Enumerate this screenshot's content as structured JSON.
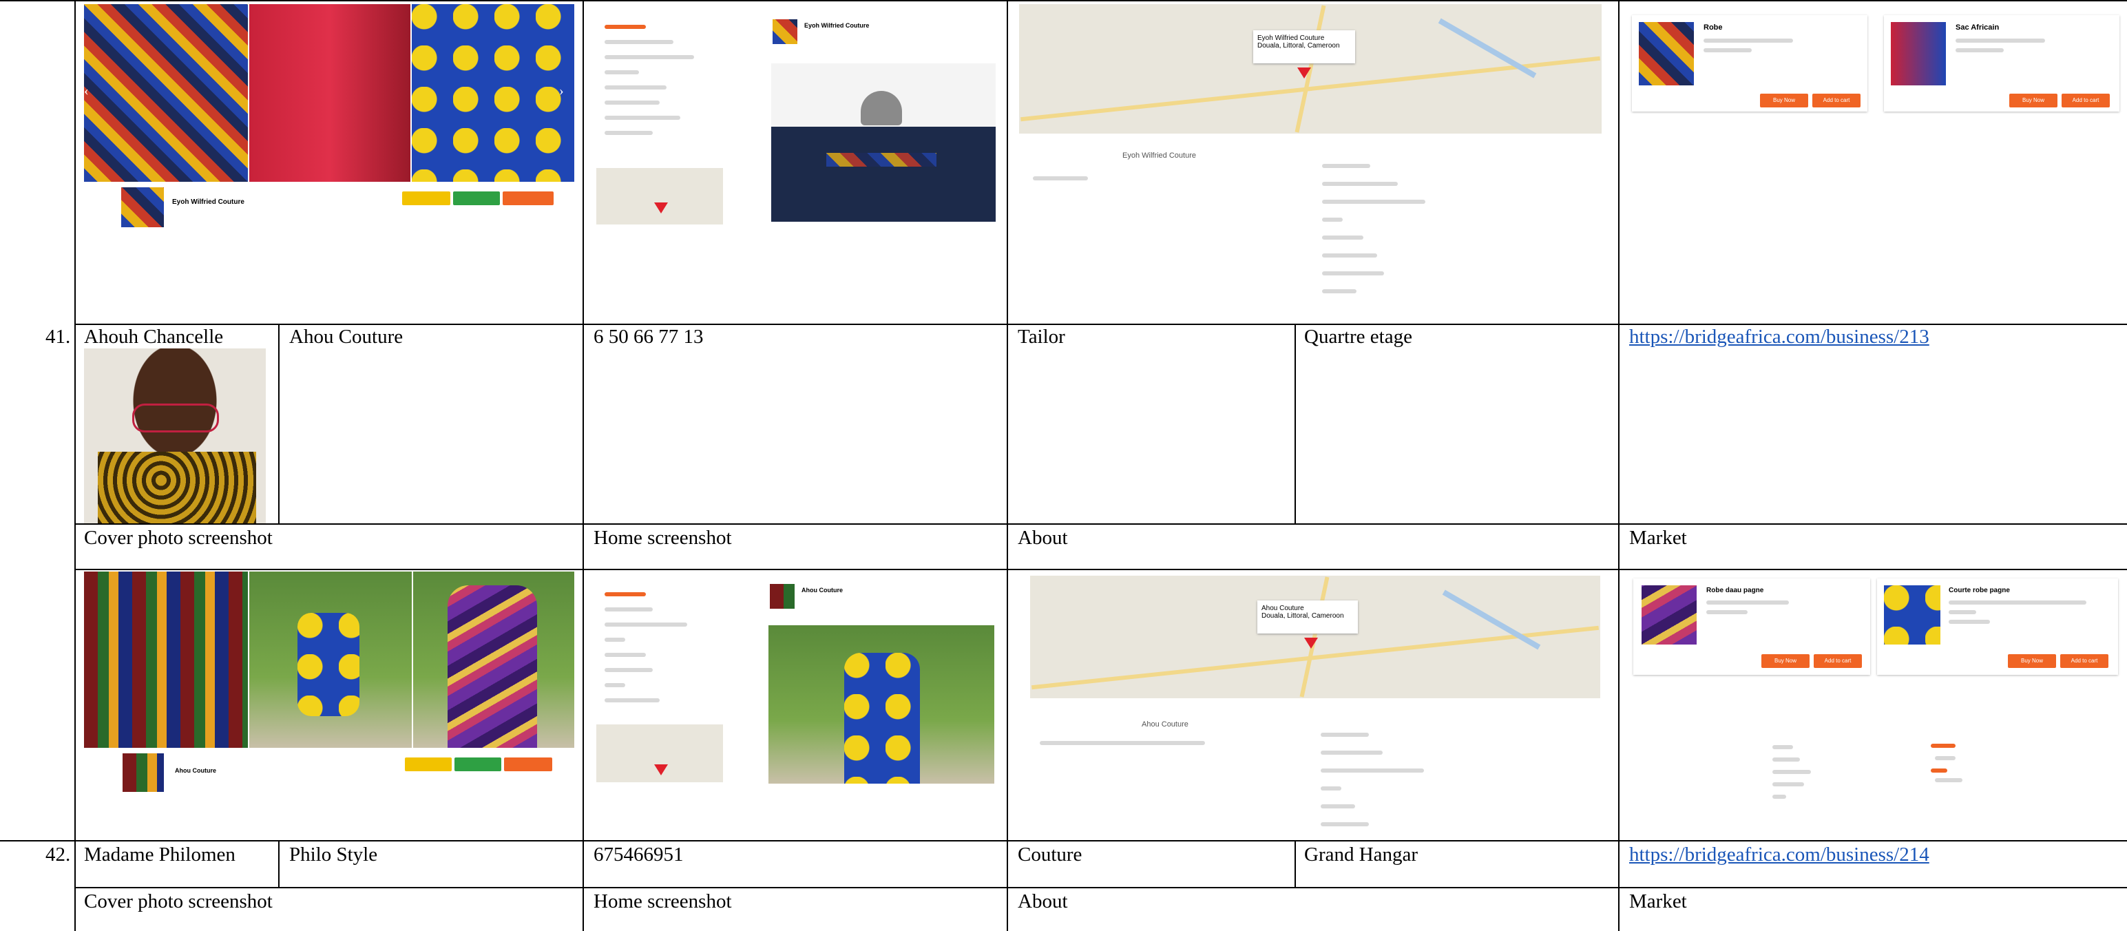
{
  "rows": {
    "r41": {
      "num": "41.",
      "owner": "Ahouh Chancelle",
      "business": "Ahou Couture",
      "phone": "6 50 66 77 13",
      "category": "Tailor",
      "location": "Quartre etage",
      "link": "https://bridgeafrica.com/business/213"
    },
    "r42": {
      "num": "42.",
      "owner": "Madame Philomen",
      "business": "Philo Style",
      "phone": "675466951",
      "category": "Couture",
      "location": "Grand Hangar",
      "link": "https://bridgeafrica.com/business/214"
    }
  },
  "sections": {
    "cover": "Cover photo screenshot",
    "home": "Home screenshot",
    "about": "About",
    "market": "Market"
  },
  "screenshots": {
    "top": {
      "cover_name": "Eyoh Wilfried Couture",
      "home_name": "Eyoh Wilfried Couture",
      "about_pin_label": "Eyoh Wilfried Couture",
      "about_map_popup": "Eyoh Wilfried Couture\nDouala, Littoral, Cameroon",
      "market_item1": "Robe",
      "market_item2": "Sac Africain",
      "buy_label": "Buy Now",
      "cart_label": "Add to cart"
    },
    "r41": {
      "cover_name": "Ahou Couture",
      "home_name": "Ahou Couture",
      "about_pin_label": "Ahou Couture",
      "about_map_popup": "Ahou Couture\nDouala, Littoral, Cameroon",
      "market_item1": "Robe daau pagne",
      "market_item2": "Courte robe pagne",
      "buy_label": "Buy Now",
      "cart_label": "Add to cart"
    }
  },
  "colors": {
    "link": "#1a56b8",
    "accent_orange": "#f06424",
    "accent_green": "#2ea043",
    "accent_yellow": "#f2c200",
    "map_pin": "#e0202a"
  }
}
